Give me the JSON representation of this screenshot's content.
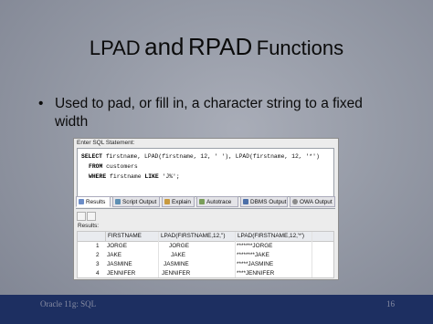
{
  "slide": {
    "title_part1": "LPAD",
    "title_part2": "and",
    "title_part3": "RPAD",
    "title_part4": "Functions",
    "bullet_text": "Used to pad, or fill in, a character string to a fixed width"
  },
  "sql_panel": {
    "header": "Enter SQL Statement:",
    "line1_kw": "SELECT",
    "line1_rest": " firstname, LPAD(firstname, 12, ' '), LPAD(firstname, 12, '*')",
    "line2_kw": "FROM",
    "line2_rest": " customers",
    "line3_kw": "WHERE",
    "line3_mid": " firstname ",
    "line3_kw2": "LIKE",
    "line3_rest": " 'J%';"
  },
  "tabs": [
    {
      "label": "Results",
      "icon": "grid-icon"
    },
    {
      "label": "Script Output",
      "icon": "script-icon"
    },
    {
      "label": "Explain",
      "icon": "explain-icon"
    },
    {
      "label": "Autotrace",
      "icon": "autotrace-icon"
    },
    {
      "label": "DBMS Output",
      "icon": "dbms-icon"
    },
    {
      "label": "OWA Output",
      "icon": "owa-icon"
    }
  ],
  "results": {
    "label": "Results:",
    "columns": [
      "FIRSTNAME",
      "LPAD(FIRSTNAME,12,'')",
      "LPAD(FIRSTNAME,12,'*')"
    ],
    "rows": [
      {
        "num": "1",
        "c1": "JORGE",
        "c2": "JORGE",
        "c3": "*******JORGE"
      },
      {
        "num": "2",
        "c1": "JAKE",
        "c2": "JAKE",
        "c3": "********JAKE"
      },
      {
        "num": "3",
        "c1": "JASMINE",
        "c2": "JASMINE",
        "c3": "*****JASMINE"
      },
      {
        "num": "4",
        "c1": "JENNIFER",
        "c2": "JENNIFER",
        "c3": "****JENNIFER"
      }
    ]
  },
  "footer": {
    "left": "Oracle 11g: SQL",
    "right": "16"
  }
}
